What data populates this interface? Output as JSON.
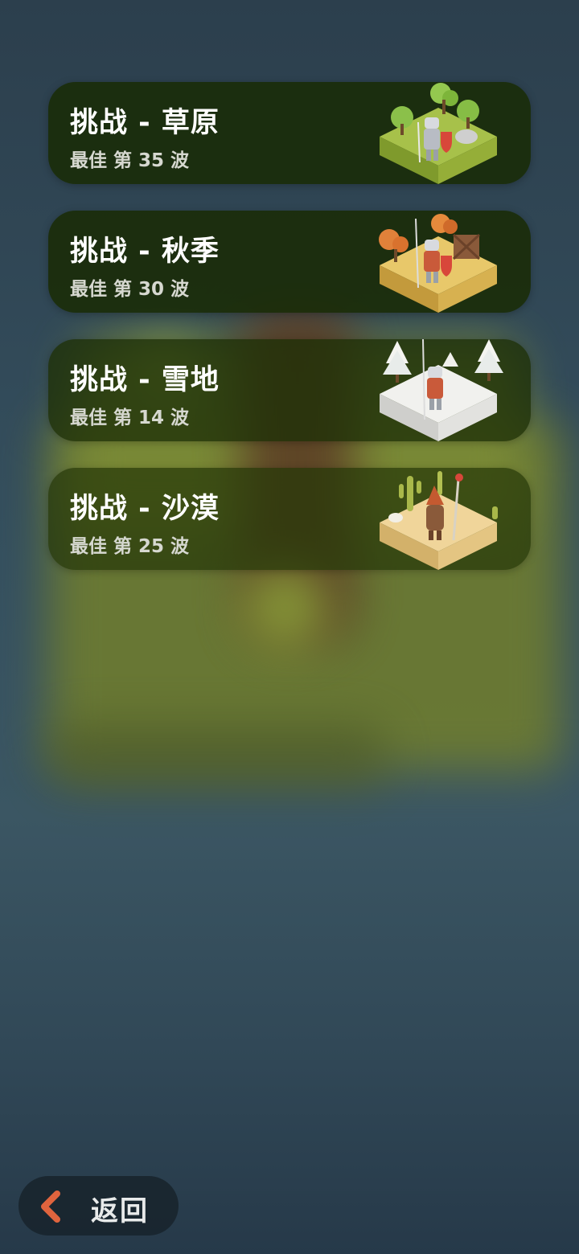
{
  "challenges": [
    {
      "title": "挑战 - 草原",
      "best": "最佳 第 35 波",
      "theme": "grassland",
      "ground_top": "#a7c14a",
      "ground_left": "#7f9a2c",
      "ground_right": "#95ae38",
      "accent": "#7db53a"
    },
    {
      "title": "挑战 - 秋季",
      "best": "最佳 第 30 波",
      "theme": "autumn",
      "ground_top": "#e8c86a",
      "ground_left": "#c39a3c",
      "ground_right": "#d7b150",
      "accent": "#e28a36"
    },
    {
      "title": "挑战 - 雪地",
      "best": "最佳 第 14 波",
      "theme": "snow",
      "ground_top": "#f1f1ee",
      "ground_left": "#cfcfcc",
      "ground_right": "#e2e2df",
      "accent": "#ffffff"
    },
    {
      "title": "挑战 - 沙漠",
      "best": "最佳 第 25 波",
      "theme": "desert",
      "ground_top": "#f0d59a",
      "ground_left": "#d3b16a",
      "ground_right": "#e4c582",
      "accent": "#a7b64a"
    }
  ],
  "back_button": {
    "label": "返回",
    "icon": "chevron-left-icon",
    "icon_color": "#e0643e"
  }
}
